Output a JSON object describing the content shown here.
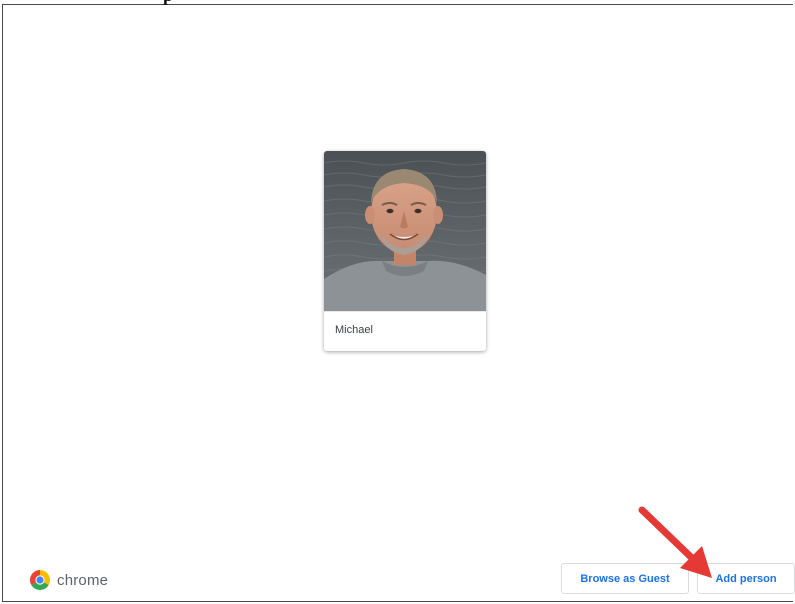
{
  "header": {
    "title_fragment": "p"
  },
  "profiles": [
    {
      "name": "Michael"
    }
  ],
  "branding": {
    "product_name": "chrome",
    "icon": "chrome-logo-icon"
  },
  "actions": {
    "browse_as_guest_label": "Browse as Guest",
    "add_person_label": "Add person"
  },
  "annotation": {
    "icon": "red-arrow-icon",
    "color": "#e53935"
  },
  "colors": {
    "accent": "#1a73e8",
    "button_border": "#dadce0",
    "text_secondary": "#5f6368"
  }
}
